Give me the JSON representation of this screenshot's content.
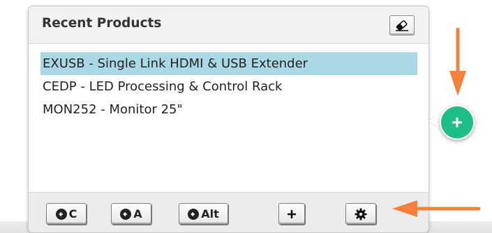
{
  "panel": {
    "title": "Recent Products",
    "clear_icon": "eraser-icon"
  },
  "products": [
    {
      "label": "EXUSB - Single Link HDMI & USB Extender",
      "selected": true
    },
    {
      "label": "CEDP - LED Processing & Control Rack",
      "selected": false
    },
    {
      "label": "MON252 - Monitor 25\"",
      "selected": false
    }
  ],
  "footer": {
    "buttons": [
      {
        "label": "C",
        "icon": "circle-arrow-left-icon"
      },
      {
        "label": "A",
        "icon": "circle-arrow-left-icon"
      },
      {
        "label": "Alt",
        "icon": "circle-arrow-left-icon"
      },
      {
        "label": "",
        "icon": "plus-icon"
      },
      {
        "label": "",
        "icon": "gear-icon"
      }
    ]
  },
  "fab": {
    "icon": "plus-icon",
    "color": "#1fbe86"
  },
  "annotations": {
    "arrow_color": "#f4813b"
  },
  "colors": {
    "selected_row": "#abd8e5"
  }
}
